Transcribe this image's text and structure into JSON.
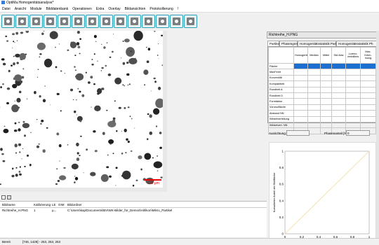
{
  "window": {
    "title": "OptiMa.Homogenitätsanalyse*"
  },
  "menu": [
    "Datei",
    "Ansicht",
    "Module",
    "Bilddatenbank",
    "Operationen",
    "Extra",
    "Overlay",
    "Bildansichten",
    "Protokollierung",
    "!"
  ],
  "toolbar": [
    "image-icon",
    "save-icon",
    "compare-icon",
    "analyze-icon",
    "sliders-icon",
    "zoom-in-icon",
    "zoom-fit-icon",
    "zoom-out-icon",
    "fullscreen-icon",
    "expand-icon",
    "particle-icon",
    "tool-icon",
    "table-icon",
    "report-icon"
  ],
  "image": {
    "scalebar_label": "100 µm"
  },
  "files": {
    "headers": [
      "Bildname",
      "Kalibrierung",
      "LE",
      "GIM",
      "Bildordner"
    ],
    "rows": [
      {
        "name": "Richtreihe_H.PNG",
        "calibration": "1",
        "le": "µ...",
        "gim": "",
        "folder": "C:\\Users\\kap\\Documents\\BVIWK-Bilder_für_Demos\\Hirlikon\\Mikro_Partikel"
      }
    ]
  },
  "status": {
    "mode": "Bereit",
    "readout": "[746, 1429] - 253, 253, 253"
  },
  "panel": {
    "title": "Richtreihe_H.PNG",
    "tabs": [
      "Partikel",
      "Phasengrenze",
      "Homogenitätsstatistik Partikel",
      "Homogenitätsstatistik Ph"
    ],
    "columns": [
      "",
      "Homogenität",
      "Median",
      "Mittel",
      "Std Abw",
      "Lorenz-verhältnis",
      "Max. Krüm-mung"
    ],
    "rows": [
      "Fläche",
      "MaxFeret",
      "Konvexität",
      "Kompaktheit",
      "Rundheit A",
      "Rundheit D",
      "Formfaktor",
      "Voronoifläche",
      "Abstand NN",
      "Winkelverteilung",
      "Winkelvert. NN"
    ],
    "ausrichtung_label": "Ausrichtung:",
    "ausrichtung_value": "",
    "phasenanteil_label": "Phasenanteil [%]:",
    "phasenanteil_value": "0"
  },
  "chart_data": {
    "type": "line",
    "ylabel": "Kumulierter Anteil der Bildfläche",
    "xlabel": "",
    "xlim": [
      0,
      1
    ],
    "ylim": [
      0,
      1
    ],
    "x_ticks": [
      "0",
      "0.2",
      "0.4",
      "0.6",
      "0.8",
      "1"
    ],
    "y_ticks": [
      "0",
      "0.2",
      "0.4",
      "0.6",
      "0.8",
      "1"
    ],
    "series": [
      {
        "x": [
          0,
          1
        ],
        "y": [
          0,
          1
        ],
        "color": "#f3e2b0"
      }
    ]
  },
  "colors": {
    "accent": "#2a9fb8",
    "selection": "#1a6fd1"
  }
}
